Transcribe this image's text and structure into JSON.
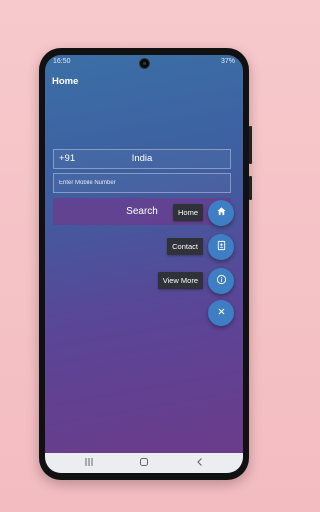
{
  "status_bar": {
    "time": "16:50",
    "right": "37%"
  },
  "header": {
    "title": "Home"
  },
  "country": {
    "code": "+91",
    "name": "India"
  },
  "mobile": {
    "placeholder": "Enter Mobile Number",
    "value": ""
  },
  "search": {
    "label": "Search"
  },
  "fab_menu": [
    {
      "label": "Home",
      "icon": "home-icon"
    },
    {
      "label": "Contact",
      "icon": "contact-icon"
    },
    {
      "label": "View More",
      "icon": "info-icon"
    }
  ],
  "fab_close": {
    "icon": "close-icon"
  },
  "colors": {
    "fab": "#3e7ec4",
    "label_bg": "#2f3238",
    "search_bg": "#6e3a8c"
  }
}
